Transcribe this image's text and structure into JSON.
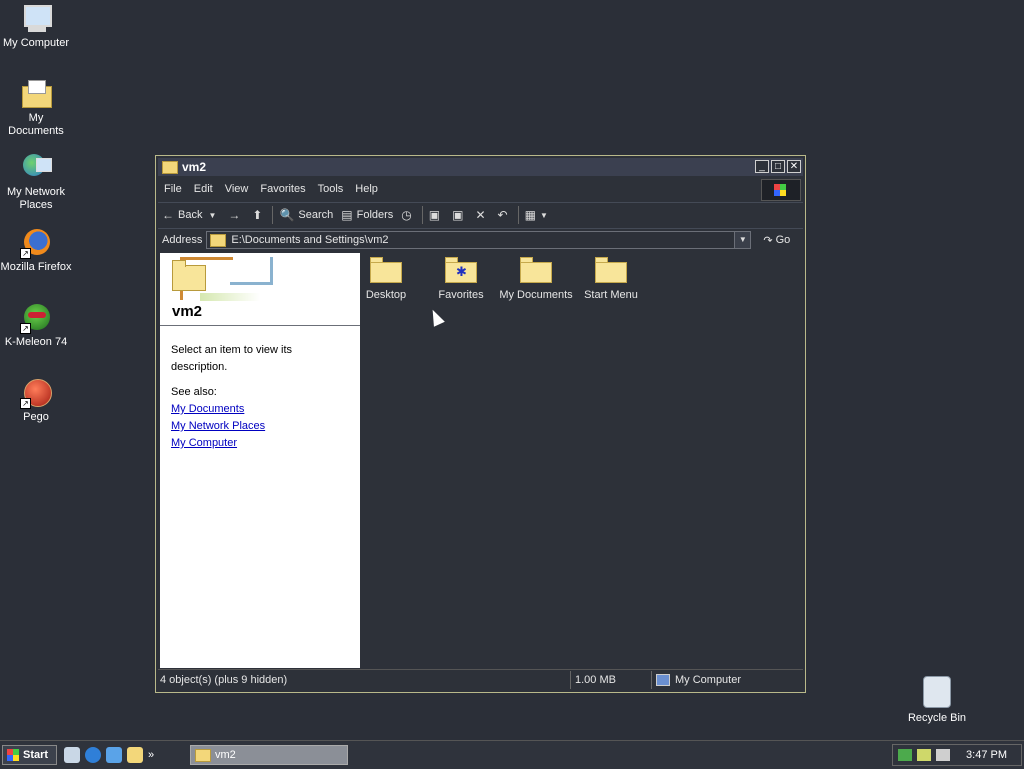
{
  "desktop": {
    "icons": [
      {
        "label": "My Computer",
        "icon": "my-computer-icon"
      },
      {
        "label": "My Documents",
        "icon": "my-documents-icon"
      },
      {
        "label": "My Network Places",
        "icon": "network-places-icon"
      },
      {
        "label": "Mozilla Firefox",
        "icon": "firefox-icon"
      },
      {
        "label": "K-Meleon 74",
        "icon": "kmeleon-icon"
      },
      {
        "label": "Pego",
        "icon": "pego-icon"
      }
    ],
    "recycle_bin": {
      "label": "Recycle Bin",
      "icon": "recycle-bin-icon"
    }
  },
  "window": {
    "title": "vm2",
    "menu": [
      "File",
      "Edit",
      "View",
      "Favorites",
      "Tools",
      "Help"
    ],
    "toolbar": {
      "back": "Back",
      "search": "Search",
      "folders": "Folders"
    },
    "address": {
      "label": "Address",
      "value": "E:\\Documents and Settings\\vm2",
      "go": "Go"
    },
    "left_pane": {
      "title": "vm2",
      "description": "Select an item to view its description.",
      "see_also": "See also:",
      "links": [
        "My Documents",
        "My Network Places",
        "My Computer"
      ]
    },
    "items": [
      {
        "label": "Desktop"
      },
      {
        "label": "Favorites"
      },
      {
        "label": "My Documents"
      },
      {
        "label": "Start Menu"
      }
    ],
    "status": {
      "objects": "4 object(s) (plus 9 hidden)",
      "size": "1.00 MB",
      "location": "My Computer"
    }
  },
  "taskbar": {
    "start": "Start",
    "task": "vm2",
    "clock": "3:47 PM"
  },
  "colors": {
    "desktop": "#2b2f38",
    "folder": "#f8e59a",
    "link": "#0000c0"
  }
}
